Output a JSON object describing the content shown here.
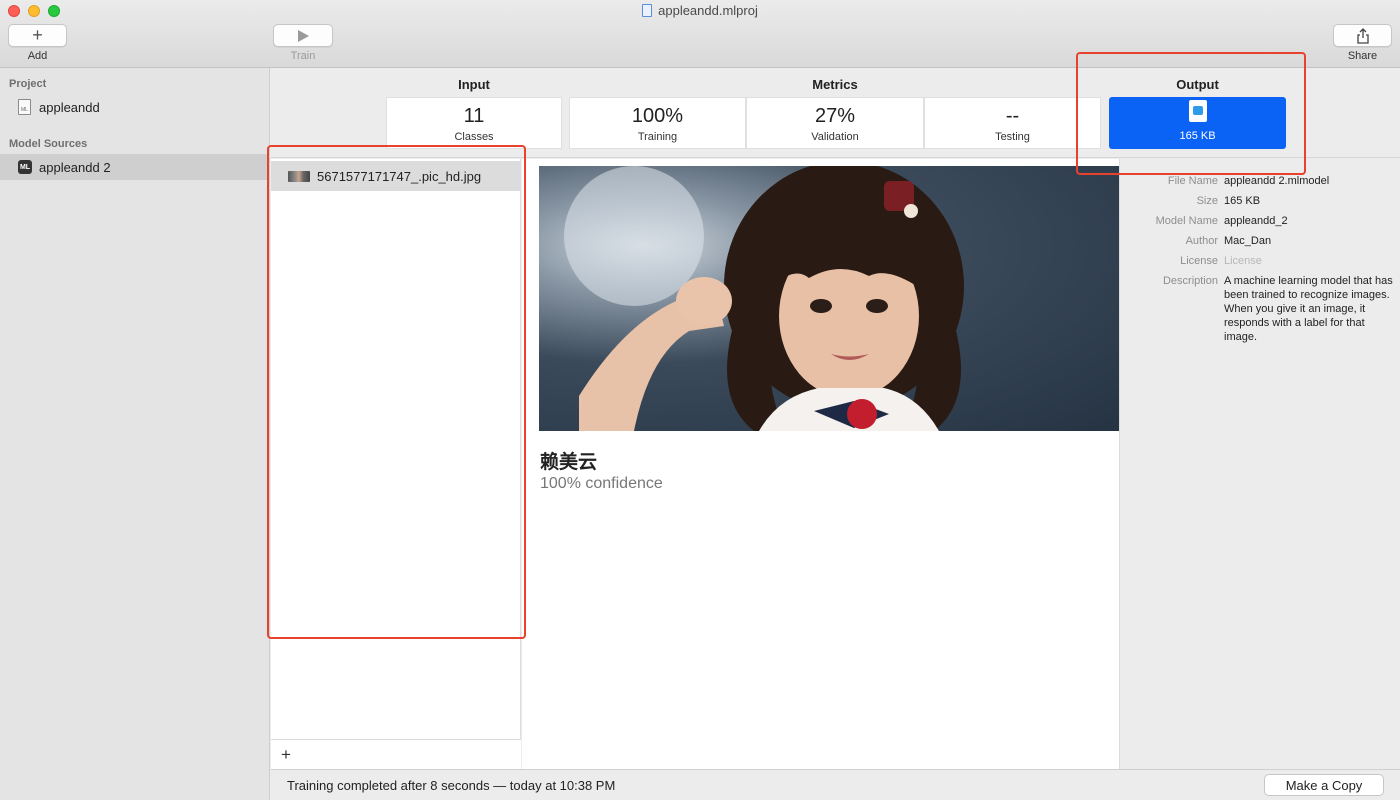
{
  "window": {
    "title": "appleandd.mlproj"
  },
  "toolbar": {
    "add_label": "Add",
    "train_label": "Train",
    "share_label": "Share"
  },
  "sidebar": {
    "project_heading": "Project",
    "project_item": "appleandd",
    "sources_heading": "Model Sources",
    "source_item": "appleandd 2",
    "source_icon_text": "ML",
    "project_icon_text": "ML"
  },
  "metrics": {
    "input_title": "Input",
    "metrics_title": "Metrics",
    "output_title": "Output",
    "classes_value": "11",
    "classes_label": "Classes",
    "training_value": "100%",
    "training_label": "Training",
    "validation_value": "27%",
    "validation_label": "Validation",
    "testing_value": "--",
    "testing_label": "Testing",
    "output_size": "165 KB"
  },
  "files": {
    "items": [
      "5671577171747_.pic_hd.jpg"
    ],
    "add_icon": "plus-icon"
  },
  "preview": {
    "prediction_label": "赖美云",
    "confidence": "100% confidence"
  },
  "info": {
    "file_name_key": "File Name",
    "file_name": "appleandd 2.mlmodel",
    "size_key": "Size",
    "size": "165 KB",
    "model_name_key": "Model Name",
    "model_name": "appleandd_2",
    "author_key": "Author",
    "author": "Mac_Dan",
    "license_key": "License",
    "license": "License",
    "description_key": "Description",
    "description": "A machine learning model that has been trained to recognize images. When you give it an image, it responds with a label for that image."
  },
  "status": {
    "text": "Training completed after 8 seconds — today at 10:38 PM",
    "make_copy_label": "Make a Copy"
  },
  "colors": {
    "accent": "#0b63f6",
    "annotation": "#e8422f"
  }
}
